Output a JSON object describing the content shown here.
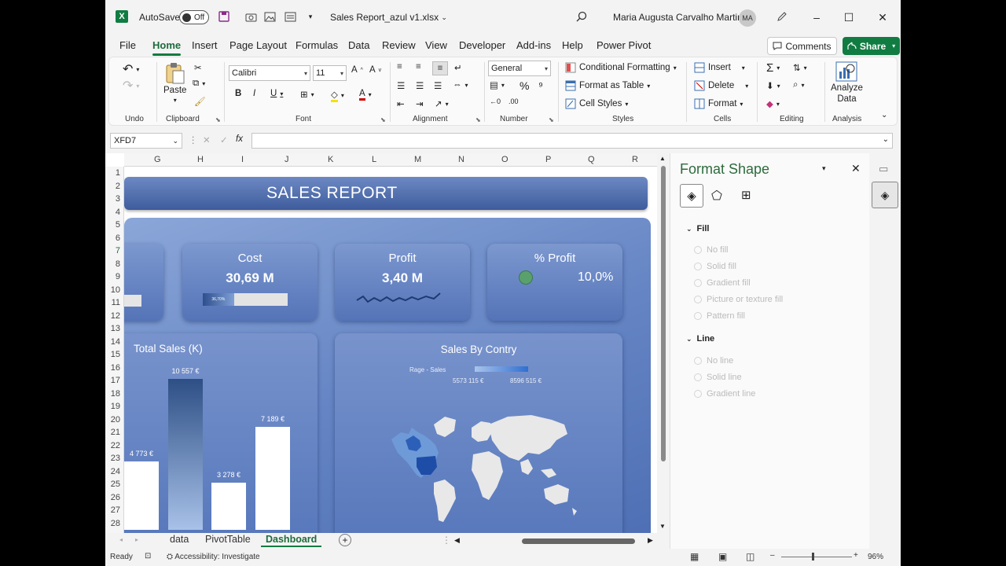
{
  "titlebar": {
    "autosave_label": "AutoSave",
    "autosave_state": "Off",
    "filename": "Sales Report_azul v1.xlsx",
    "user_name": "Maria Augusta Carvalho Martins",
    "user_initials": "MA"
  },
  "tabs": [
    "File",
    "Home",
    "Insert",
    "Page Layout",
    "Formulas",
    "Data",
    "Review",
    "View",
    "Developer",
    "Add-ins",
    "Help",
    "Power Pivot"
  ],
  "actions": {
    "comments": "Comments",
    "share": "Share"
  },
  "ribbon": {
    "groups": [
      "Undo",
      "Clipboard",
      "Font",
      "Alignment",
      "Number",
      "Styles",
      "Cells",
      "Editing",
      "Analysis"
    ],
    "paste_label": "Paste",
    "font_name": "Calibri",
    "font_size": "11",
    "number_format": "General",
    "styles": [
      "Conditional Formatting",
      "Format as Table",
      "Cell Styles"
    ],
    "cells": [
      "Insert",
      "Delete",
      "Format"
    ],
    "analyze_data": [
      "Analyze",
      "Data"
    ]
  },
  "formula_bar": {
    "name_box": "XFD7",
    "fx": "fx",
    "value": ""
  },
  "columns": [
    "G",
    "H",
    "I",
    "J",
    "K",
    "L",
    "M",
    "N",
    "O",
    "P",
    "Q",
    "R"
  ],
  "rows": [
    "1",
    "2",
    "3",
    "4",
    "5",
    "6",
    "7",
    "8",
    "9",
    "10",
    "11",
    "12",
    "13",
    "14",
    "15",
    "16",
    "17",
    "18",
    "19",
    "20",
    "21",
    "22",
    "23",
    "24",
    "25",
    "26",
    "27",
    "28"
  ],
  "dashboard": {
    "title": "SALES REPORT",
    "kpis": {
      "cost": {
        "title": "Cost",
        "value": "30,69 M",
        "bar_label": "36,70%"
      },
      "profit": {
        "title": "Profit",
        "value": "3,40 M"
      },
      "pct_profit": {
        "title": "% Profit",
        "value": "10,0%"
      }
    },
    "total_sales": {
      "title": "Total Sales (K)",
      "bars": [
        {
          "label": "4 773 €",
          "value": 4773
        },
        {
          "label": "10 557 €",
          "value": 10557
        },
        {
          "label": "3 278 €",
          "value": 3278
        },
        {
          "label": "7 189 €",
          "value": 7189
        }
      ]
    },
    "map": {
      "title": "Sales By Contry",
      "legend_title": "Rage - Sales",
      "legend_min": "5573 115 €",
      "legend_max": "8596 515 €"
    }
  },
  "sheet_tabs": [
    "data",
    "PivotTable",
    "Dashboard"
  ],
  "active_sheet": "Dashboard",
  "status": {
    "ready": "Ready",
    "accessibility": "Accessibility: Investigate",
    "zoom": "96%"
  },
  "format_pane": {
    "title": "Format Shape",
    "fill_section": "Fill",
    "fill_options": [
      "No fill",
      "Solid fill",
      "Gradient fill",
      "Picture or texture fill",
      "Pattern fill"
    ],
    "line_section": "Line",
    "line_options": [
      "No line",
      "Solid line",
      "Gradient line"
    ]
  },
  "colors": {
    "excel_green": "#107c41",
    "dashboard_blue": "#5677bb"
  }
}
